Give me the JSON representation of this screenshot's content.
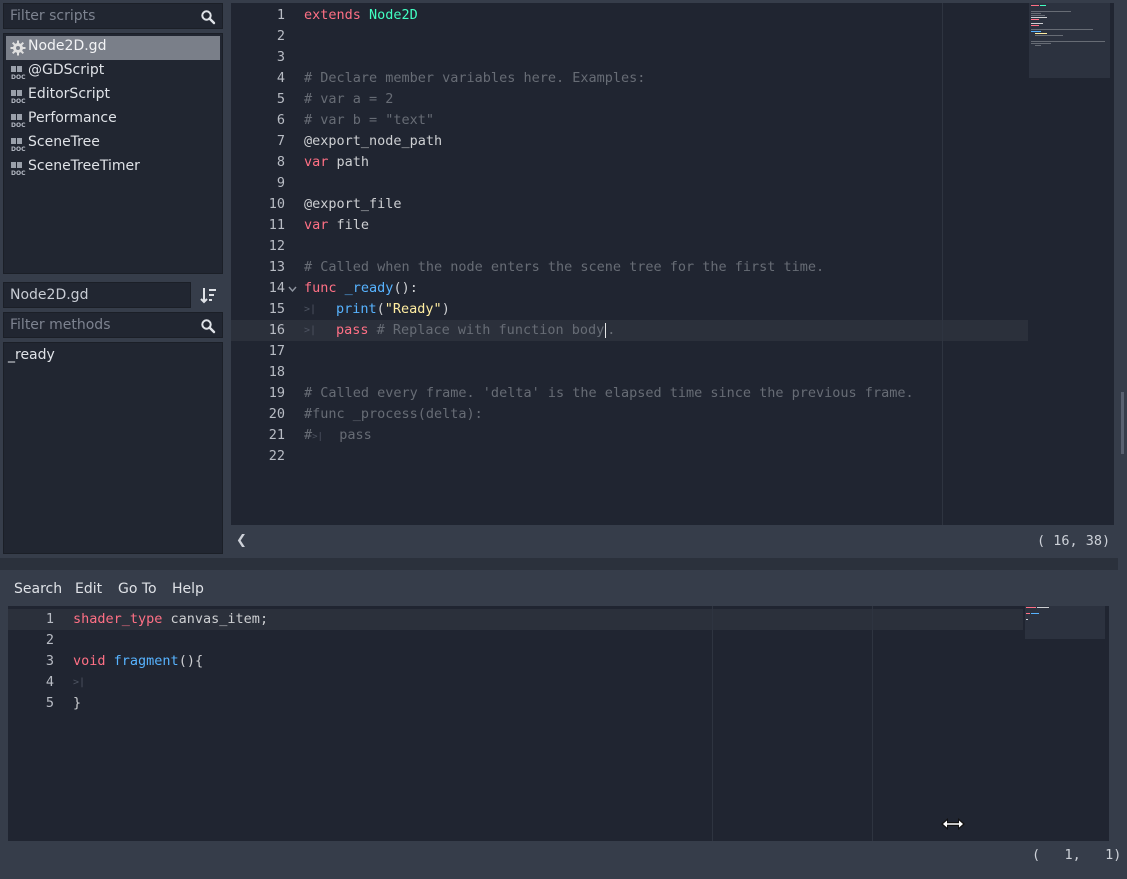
{
  "left_panel": {
    "filter_scripts_placeholder": "Filter scripts",
    "scripts": [
      {
        "label": "Node2D.gd",
        "icon": "gear-icon",
        "selected": true
      },
      {
        "label": "@GDScript",
        "icon": "doc-icon",
        "selected": false
      },
      {
        "label": "EditorScript",
        "icon": "doc-icon",
        "selected": false
      },
      {
        "label": "Performance",
        "icon": "doc-icon",
        "selected": false
      },
      {
        "label": "SceneTree",
        "icon": "doc-icon",
        "selected": false
      },
      {
        "label": "SceneTreeTimer",
        "icon": "doc-icon",
        "selected": false
      }
    ],
    "current_script_name": "Node2D.gd",
    "filter_methods_placeholder": "Filter methods",
    "methods": [
      "_ready"
    ]
  },
  "script_editor": {
    "lines": [
      "1",
      "2",
      "3",
      "4",
      "5",
      "6",
      "7",
      "8",
      "9",
      "10",
      "11",
      "12",
      "13",
      "14",
      "15",
      "16",
      "17",
      "18",
      "19",
      "20",
      "21",
      "22"
    ],
    "code": {
      "l1_kw": "extends",
      "l1_type": "Node2D",
      "l4": "# Declare member variables here. Examples:",
      "l5": "# var a = 2",
      "l6": "# var b = \"text\"",
      "l7": "@export_node_path",
      "l8_kw": "var",
      "l8_rest": " path",
      "l10": "@export_file",
      "l11_kw": "var",
      "l11_rest": " file",
      "l13": "# Called when the node enters the scene tree for the first time.",
      "l14_kw": "func",
      "l14_fn": "_ready",
      "l14_rest": "():",
      "l15_fn": "print",
      "l15_p1": "(",
      "l15_str": "\"Ready\"",
      "l15_p2": ")",
      "l16_kw": "pass",
      "l16_cmt": " # Replace with function body",
      "l16_after_caret": ".",
      "l19": "# Called every frame. 'delta' is the elapsed time since the previous frame.",
      "l20": "#func _process(delta):",
      "l21_hash": "#",
      "l21_rest": "pass"
    },
    "status_position": "( 16, 38)",
    "left_arrow": "❮"
  },
  "shader_panel": {
    "menu": [
      "Search",
      "Edit",
      "Go To",
      "Help"
    ],
    "lines": [
      "1",
      "2",
      "3",
      "4",
      "5"
    ],
    "code": {
      "l1_kw": "shader_type",
      "l1_rest": " canvas_item;",
      "l3_kw": "void",
      "l3_fn": "fragment",
      "l3_rest": "(){",
      "l5": "}"
    },
    "status_position": "(   1,   1)"
  },
  "colors": {
    "keyword": "#ff7085",
    "type": "#42ffc2",
    "function": "#57b3ff",
    "string": "#ffeda1",
    "comment": "#676c75",
    "editor_bg": "#202531",
    "panel_bg": "#363d4a"
  }
}
